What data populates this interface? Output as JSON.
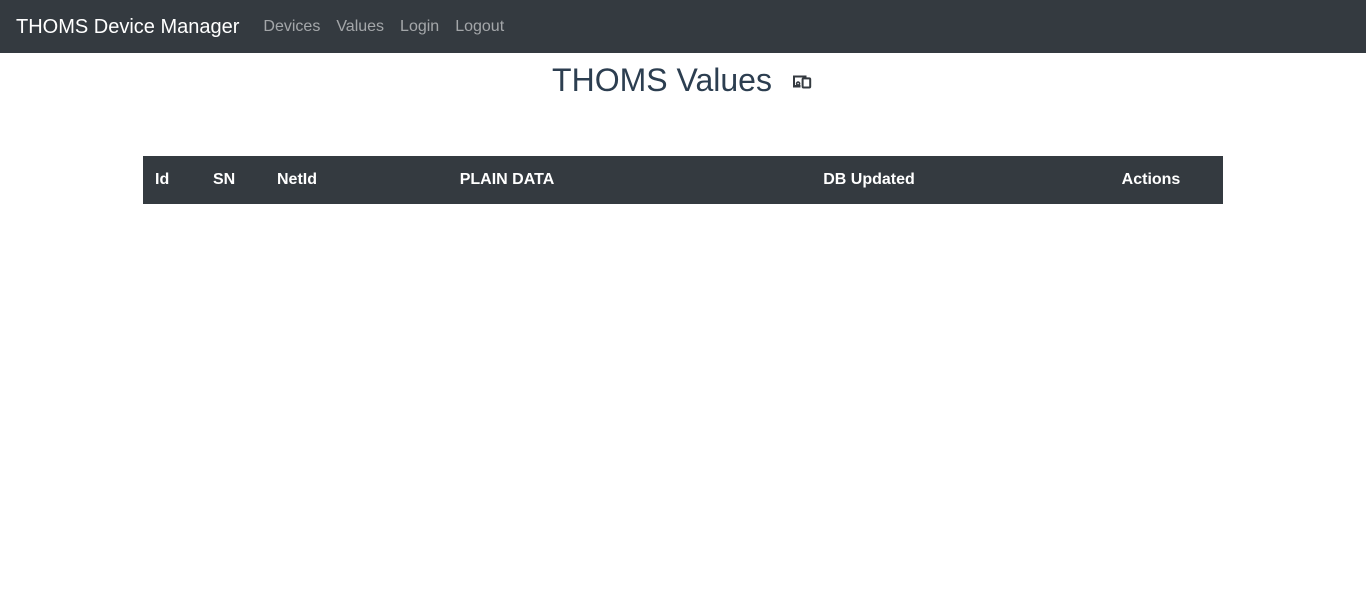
{
  "navbar": {
    "brand": "THOMS Device Manager",
    "links": [
      {
        "label": "Devices"
      },
      {
        "label": "Values"
      },
      {
        "label": "Login"
      },
      {
        "label": "Logout"
      }
    ]
  },
  "page": {
    "title": "THOMS Values",
    "title_icon": "devices-icon"
  },
  "table": {
    "headers": [
      "Id",
      "SN",
      "NetId",
      "PLAIN DATA",
      "DB Updated",
      "Actions"
    ]
  },
  "colors": {
    "navbar_bg": "#343a40",
    "table_header_bg": "#343a40",
    "title_text": "#2c3e50"
  }
}
